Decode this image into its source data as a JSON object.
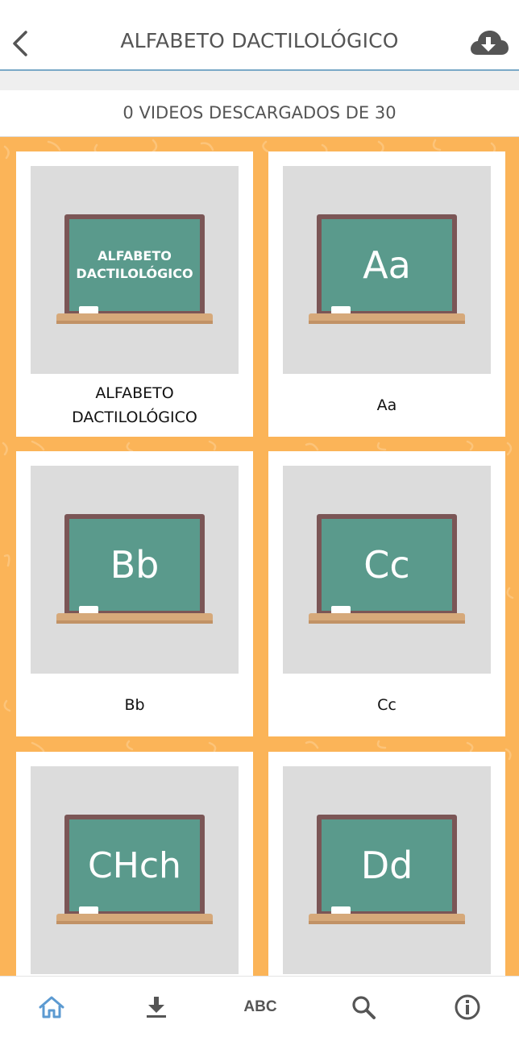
{
  "header": {
    "title": "ALFABETO DACTILOLÓGICO",
    "back_icon": "chevron-left-icon",
    "download_icon": "cloud-download-icon"
  },
  "counter": {
    "text": "0 VIDEOS DESCARGADOS DE 30"
  },
  "colors": {
    "background": "#fbb458",
    "board": "#5a9a8c",
    "board_frame": "#7b5656",
    "active_nav": "#5c9ad1",
    "inactive_nav": "#555555"
  },
  "cards": [
    {
      "board_text": "ALFABETO DACTILOLÓGICO",
      "label": "ALFABETO DACTILOLÓGICO"
    },
    {
      "board_text": "Aa",
      "label": "Aa"
    },
    {
      "board_text": "Bb",
      "label": "Bb"
    },
    {
      "board_text": "Cc",
      "label": "Cc"
    },
    {
      "board_text": "CHch",
      "label": ""
    },
    {
      "board_text": "Dd",
      "label": ""
    }
  ],
  "nav": {
    "items": [
      {
        "icon": "home-icon",
        "active": true
      },
      {
        "icon": "download-icon",
        "active": false
      },
      {
        "label": "ABC",
        "active": false
      },
      {
        "icon": "search-icon",
        "active": false
      },
      {
        "icon": "info-icon",
        "active": false
      }
    ]
  }
}
